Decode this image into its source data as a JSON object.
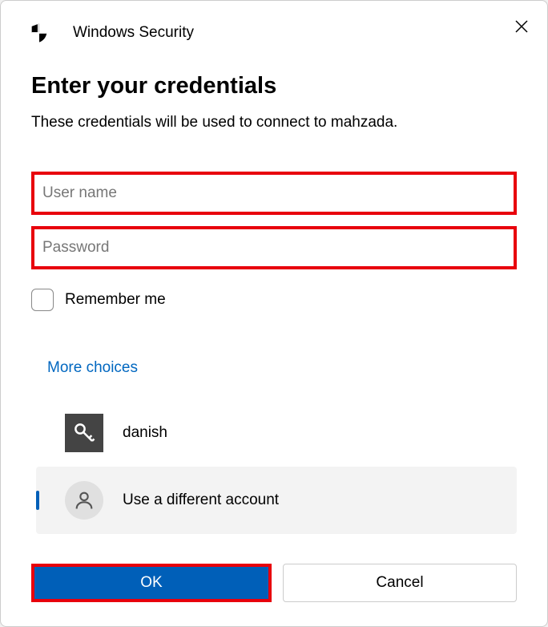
{
  "titlebar": {
    "title": "Windows Security"
  },
  "dialog": {
    "heading": "Enter your credentials",
    "subtext": "These credentials will be used to connect to mahzada.",
    "username_placeholder": "User name",
    "password_placeholder": "Password",
    "remember_label": "Remember me",
    "more_choices_label": "More choices"
  },
  "accounts": {
    "saved": {
      "label": "danish"
    },
    "different": {
      "label": "Use a different account"
    }
  },
  "buttons": {
    "ok": "OK",
    "cancel": "Cancel"
  }
}
